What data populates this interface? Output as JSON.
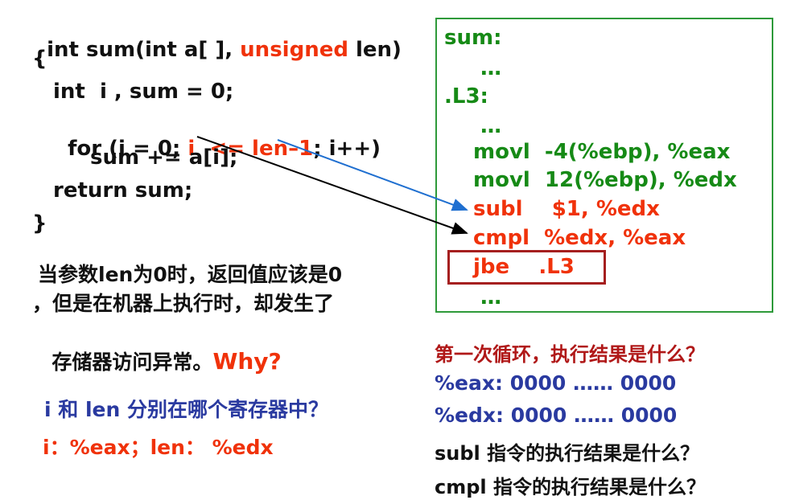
{
  "c_code": {
    "line1_a": "int sum(int a[ ], ",
    "line1_b": "unsigned",
    "line1_c": " len)",
    "line2": "{",
    "line3": "int  i , sum = 0;",
    "line4_a": "for (i = 0; ",
    "line4_b": "i  <= len–1",
    "line4_c": "; i++)",
    "line5": "sum += a[i];",
    "line6": "return sum;",
    "line7": "}"
  },
  "asm": {
    "l1": "sum:",
    "l2": "…",
    "l3": ".L3:",
    "l4": "…",
    "l5": "movl  -4(%ebp), %eax",
    "l6": "movl  12(%ebp), %edx",
    "l7": "subl    $1, %edx",
    "l8": "cmpl  %edx, %eax",
    "l9": "jbe    .L3",
    "l10": "…"
  },
  "problem": {
    "line1": "当参数len为0时，返回值应该是0",
    "line2": "，但是在机器上执行时，却发生了",
    "line3": "存储器访问异常。",
    "why": "Why?"
  },
  "register_question": "i 和 len 分别在哪个寄存器中？",
  "register_answer": "i：%eax；len： %edx",
  "right_questions": {
    "q1": "第一次循环，执行结果是什么？",
    "eax": "%eax: 0000 …… 0000",
    "edx": "%edx: 0000 …… 0000",
    "q2": "subl 指令的执行结果是什么？",
    "q3": "cmpl 指令的执行结果是什么？"
  },
  "colors": {
    "red": "#f0320a",
    "green": "#168a16",
    "blue": "#2a3aa0",
    "arrow_blue": "#1f6fd0",
    "highlight_box": "#a51f1f"
  }
}
